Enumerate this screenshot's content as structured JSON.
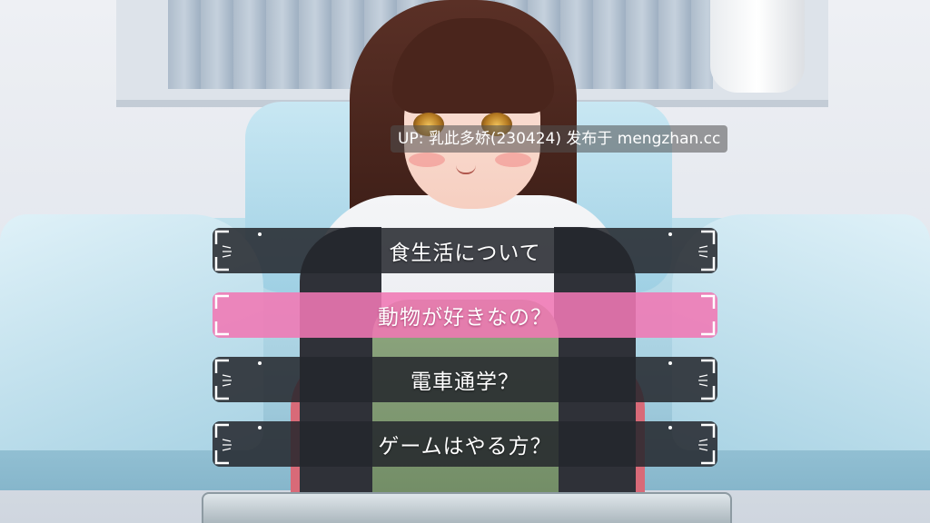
{
  "watermark": {
    "text": "UP: 乳此多娇(230424) 发布于 mengzhan.cc"
  },
  "choices": [
    {
      "label": "食生活について",
      "state": "normal"
    },
    {
      "label": "動物が好きなの？",
      "state": "selected"
    },
    {
      "label": "電車通学？",
      "state": "normal"
    },
    {
      "label": "ゲームはやる方？",
      "state": "normal"
    }
  ],
  "colors": {
    "choice_normal_bg": "#24262c",
    "choice_selected_bg": "#f078b4",
    "choice_text": "#ffffff",
    "bed_blue": "#a5cfe0",
    "hair": "#3d1e17"
  }
}
